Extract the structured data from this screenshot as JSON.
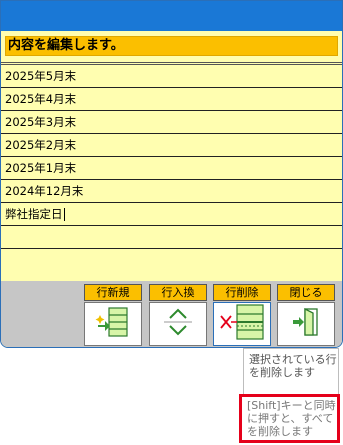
{
  "heading": "内容を編集します。",
  "rows": [
    "2025年5月末",
    "2025年4月末",
    "2025年3月末",
    "2025年2月末",
    "2025年1月末",
    "2024年12月末",
    "弊社指定日",
    "",
    ""
  ],
  "toolbar": {
    "new_label": "行新規",
    "swap_label": "行入換",
    "delete_label": "行削除",
    "close_label": "閉じる"
  },
  "tooltip": {
    "line1": "選択されている行を削除します",
    "line2": "[Shift]キーと同時に押すと、すべてを削除します"
  },
  "colors": {
    "titlebar": "#1a78d6",
    "heading_bg": "#fbbf00",
    "list_bg": "#fffeb0",
    "toolbar_bg": "#c6c6c6",
    "highlight_border": "#e5001a"
  },
  "icons": {
    "new": "add-row-icon",
    "swap": "up-down-arrows-icon",
    "delete": "delete-row-icon",
    "close": "exit-door-icon"
  }
}
